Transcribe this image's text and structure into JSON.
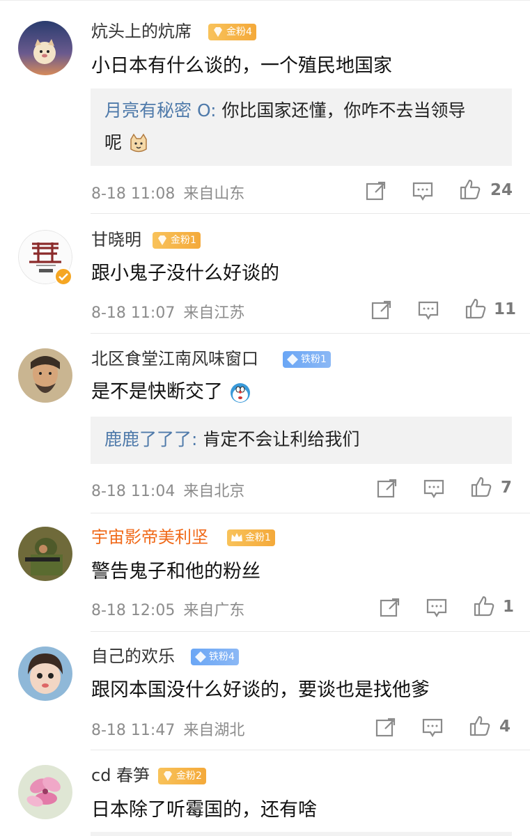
{
  "comments": [
    {
      "username": "炕头上的炕席",
      "badge": "金粉4",
      "badge_type": "gold",
      "text": "小日本有什么谈的，一个殖民地国家",
      "reply": {
        "user": "月亮有秘密 O:",
        "text_line1": " 你比国家还懂，你咋不去当领导",
        "text_line2": "呢",
        "emoji": "cat-face-emoji"
      },
      "date": "8-18 11:08",
      "location": "来自山东",
      "likes": "24"
    },
    {
      "username": "甘晓明",
      "badge": "金粉1",
      "badge_type": "gold",
      "text": "跟小鬼子没什么好谈的",
      "verified": true,
      "date": "8-18 11:07",
      "location": "来自江苏",
      "likes": "11"
    },
    {
      "username": "北区食堂江南风味窗口",
      "badge": "铁粉1",
      "badge_type": "iron",
      "text": "是不是快断交了",
      "reply": {
        "user": "鹿鹿了了了:",
        "text_line1": " 肯定不会让利给我们"
      },
      "date": "8-18 11:04",
      "location": "来自北京",
      "likes": "7"
    },
    {
      "username": "宇宙影帝美利坚",
      "badge": "金粉1",
      "badge_type": "gold",
      "text": "警告鬼子和他的粉丝",
      "date": "8-18 12:05",
      "location": "来自广东",
      "likes": "1"
    },
    {
      "username": "自己的欢乐",
      "badge": "铁粉4",
      "badge_type": "iron",
      "text": "跟冈本国没什么好谈的，要谈也是找他爹",
      "date": "8-18 11:47",
      "location": "来自湖北",
      "likes": "4"
    },
    {
      "username": "cd 春笋",
      "badge": "金粉2",
      "badge_type": "gold",
      "text": "日本除了听霉国的，还有啥"
    }
  ],
  "colors": {
    "gold_badge": "#f4a93a",
    "iron_badge": "#6aa6f5",
    "reply_user": "#4f7aaa",
    "vip_username": "#f06a1a"
  }
}
